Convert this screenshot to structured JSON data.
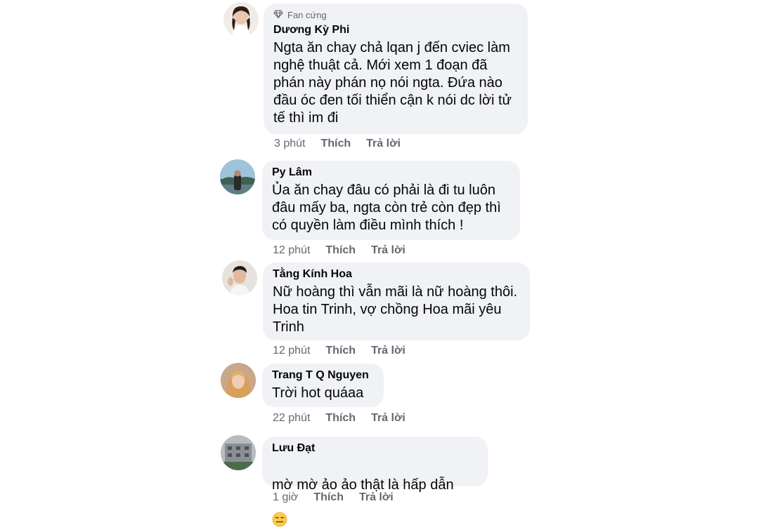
{
  "comments": [
    {
      "badge": "Fan cứng",
      "author": "Dương Kỳ Phi",
      "text": "Ngta ăn chay chả lqan j đến cviec làm\nnghệ thuật cả. Mới xem 1 đoạn đã\nphán này phán nọ nói ngta. Đứa nào\nđầu óc đen tối thiển cận k nói dc lời tử\ntế thì im đi",
      "time": "3 phút",
      "like": "Thích",
      "reply": "Trả lời"
    },
    {
      "author": "Py Lâm",
      "text": "Ủa ăn chay đâu có phải là đi tu luôn\nđâu mấy ba, ngta còn trẻ còn đẹp thì\ncó quyền làm điều mình thích !",
      "time": "12 phút",
      "like": "Thích",
      "reply": "Trả lời"
    },
    {
      "author": "Tằng Kính Hoa",
      "text": "Nữ hoàng thì vẫn mãi là nữ hoàng thôi.\nHoa tin Trinh, vợ chồng Hoa mãi yêu\nTrinh",
      "time": "12 phút",
      "like": "Thích",
      "reply": "Trả lời"
    },
    {
      "author": "Trang T Q Nguyen",
      "text": "Trời hot quáaa",
      "time": "22 phút",
      "like": "Thích",
      "reply": "Trả lời"
    },
    {
      "author": "Lưu Đạt",
      "text": "mờ mờ ảo ảo thật là hấp dẫn",
      "emoji": "expressionless-face-icon",
      "time": "1 giờ",
      "like": "Thích",
      "reply": "Trả lời"
    }
  ],
  "colors": {
    "bubble": "#f0f2f5",
    "meta": "#65676b",
    "text": "#050505"
  }
}
